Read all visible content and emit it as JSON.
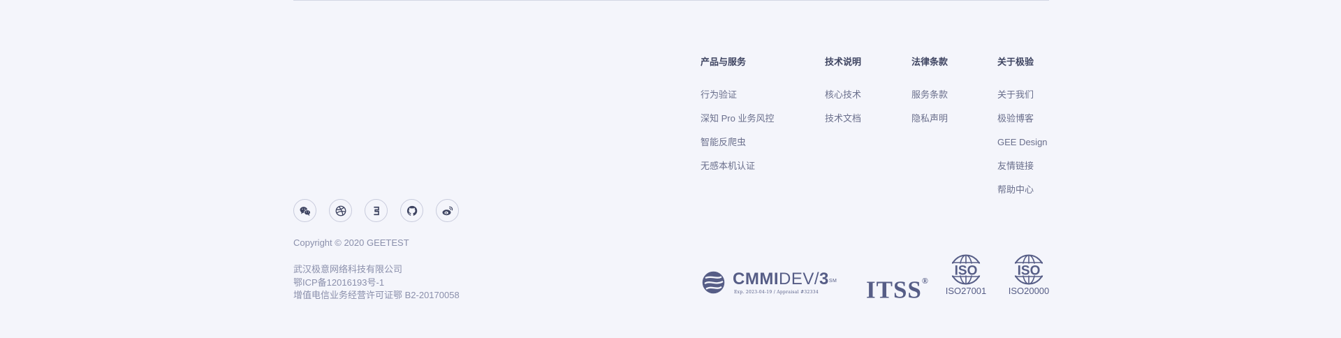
{
  "social": [
    {
      "name": "wechat"
    },
    {
      "name": "dribbble"
    },
    {
      "name": "geetest"
    },
    {
      "name": "github"
    },
    {
      "name": "weibo"
    }
  ],
  "copyright": "Copyright © 2020 GEETEST",
  "company": {
    "name": "武汉极意网络科技有限公司",
    "icp": "鄂ICP备12016193号-1",
    "license": "增值电信业务经营许可证鄂 B2-20170058"
  },
  "columns": [
    {
      "title": "产品与服务",
      "links": [
        "行为验证",
        "深知 Pro 业务风控",
        "智能反爬虫",
        "无感本机认证"
      ]
    },
    {
      "title": "技术说明",
      "links": [
        "核心技术",
        "技术文档"
      ]
    },
    {
      "title": "法律条款",
      "links": [
        "服务条款",
        "隐私声明"
      ]
    },
    {
      "title": "关于极验",
      "links": [
        "关于我们",
        "极验博客",
        "GEE Design",
        "友情链接",
        "帮助中心"
      ]
    }
  ],
  "certs": {
    "cmmi_bold": "CMMI",
    "cmmi_light": "DEV",
    "cmmi_slash": "/",
    "cmmi_level": "3",
    "cmmi_sm": "SM",
    "cmmi_exp": "Exp. 2023-04-19 / Appraisal #32334",
    "itss": "ITSS",
    "itss_mark": "®",
    "iso_word": "ISO",
    "iso_1": "ISO27001",
    "iso_2": "ISO20000"
  },
  "colors": {
    "background": "#f4f5fb",
    "title": "#3e4461",
    "link": "#6a6f8c",
    "muted": "#8a8fab",
    "logo": "#565d86"
  }
}
